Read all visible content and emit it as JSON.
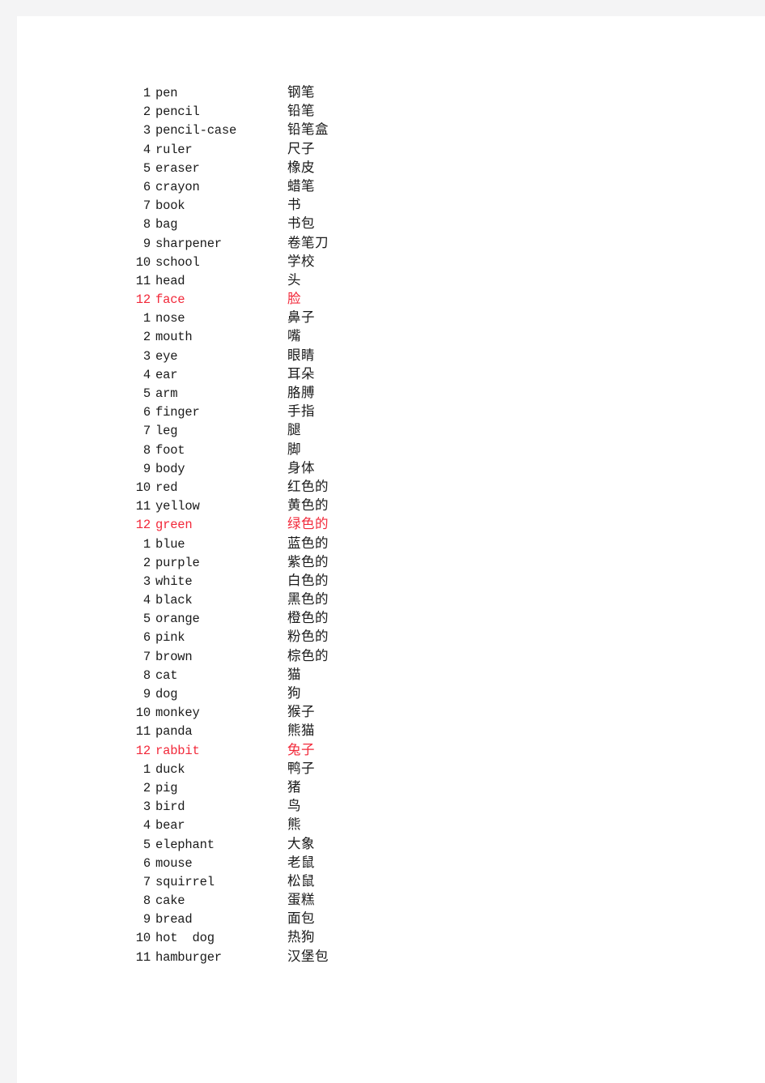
{
  "document": {
    "kind": "vocabulary-word-list",
    "accent_color": "#f2293a",
    "text_color": "#1a1a1a",
    "frame_color": "#f4f4f5",
    "page_color": "#ffffff"
  },
  "columns": {
    "index_header": "",
    "term_header": "",
    "gloss_header": ""
  },
  "rows": [
    {
      "index": "1",
      "term": "pen",
      "gloss": "钢笔",
      "highlight": false
    },
    {
      "index": "2",
      "term": "pencil",
      "gloss": "铅笔",
      "highlight": false
    },
    {
      "index": "3",
      "term": "pencil-case",
      "gloss": "铅笔盒",
      "highlight": false
    },
    {
      "index": "4",
      "term": "ruler",
      "gloss": "尺子",
      "highlight": false
    },
    {
      "index": "5",
      "term": "eraser",
      "gloss": "橡皮",
      "highlight": false
    },
    {
      "index": "6",
      "term": "crayon",
      "gloss": "蜡笔",
      "highlight": false
    },
    {
      "index": "7",
      "term": "book",
      "gloss": "书",
      "highlight": false
    },
    {
      "index": "8",
      "term": "bag",
      "gloss": "书包",
      "highlight": false
    },
    {
      "index": "9",
      "term": "sharpener",
      "gloss": "卷笔刀",
      "highlight": false
    },
    {
      "index": "10",
      "term": "school",
      "gloss": "学校",
      "highlight": false
    },
    {
      "index": "11",
      "term": "head",
      "gloss": "头",
      "highlight": false
    },
    {
      "index": "12",
      "term": "face",
      "gloss": "脸",
      "highlight": true
    },
    {
      "index": "1",
      "term": "nose",
      "gloss": "鼻子",
      "highlight": false
    },
    {
      "index": "2",
      "term": "mouth",
      "gloss": "嘴",
      "highlight": false
    },
    {
      "index": "3",
      "term": "eye",
      "gloss": "眼睛",
      "highlight": false
    },
    {
      "index": "4",
      "term": "ear",
      "gloss": "耳朵",
      "highlight": false
    },
    {
      "index": "5",
      "term": "arm",
      "gloss": "胳膊",
      "highlight": false
    },
    {
      "index": "6",
      "term": "finger",
      "gloss": "手指",
      "highlight": false
    },
    {
      "index": "7",
      "term": "leg",
      "gloss": "腿",
      "highlight": false
    },
    {
      "index": "8",
      "term": "foot",
      "gloss": "脚",
      "highlight": false
    },
    {
      "index": "9",
      "term": "body",
      "gloss": "身体",
      "highlight": false
    },
    {
      "index": "10",
      "term": "red",
      "gloss": "红色的",
      "highlight": false
    },
    {
      "index": "11",
      "term": "yellow",
      "gloss": "黄色的",
      "highlight": false
    },
    {
      "index": "12",
      "term": "green",
      "gloss": "绿色的",
      "highlight": true
    },
    {
      "index": "1",
      "term": "blue",
      "gloss": "蓝色的",
      "highlight": false
    },
    {
      "index": "2",
      "term": "purple",
      "gloss": "紫色的",
      "highlight": false
    },
    {
      "index": "3",
      "term": "white",
      "gloss": "白色的",
      "highlight": false
    },
    {
      "index": "4",
      "term": "black",
      "gloss": "黑色的",
      "highlight": false
    },
    {
      "index": "5",
      "term": "orange",
      "gloss": "橙色的",
      "highlight": false
    },
    {
      "index": "6",
      "term": "pink",
      "gloss": "粉色的",
      "highlight": false
    },
    {
      "index": "7",
      "term": "brown",
      "gloss": "棕色的",
      "highlight": false
    },
    {
      "index": "8",
      "term": "cat",
      "gloss": "猫",
      "highlight": false
    },
    {
      "index": "9",
      "term": "dog",
      "gloss": "狗",
      "highlight": false
    },
    {
      "index": "10",
      "term": "monkey",
      "gloss": "猴子",
      "highlight": false
    },
    {
      "index": "11",
      "term": "panda",
      "gloss": "熊猫",
      "highlight": false
    },
    {
      "index": "12",
      "term": "rabbit",
      "gloss": "兔子",
      "highlight": true
    },
    {
      "index": "1",
      "term": "duck",
      "gloss": "鸭子",
      "highlight": false
    },
    {
      "index": "2",
      "term": "pig",
      "gloss": "猪",
      "highlight": false
    },
    {
      "index": "3",
      "term": "bird",
      "gloss": "鸟",
      "highlight": false
    },
    {
      "index": "4",
      "term": "bear",
      "gloss": "熊",
      "highlight": false
    },
    {
      "index": "5",
      "term": "elephant",
      "gloss": "大象",
      "highlight": false
    },
    {
      "index": "6",
      "term": "mouse",
      "gloss": "老鼠",
      "highlight": false
    },
    {
      "index": "7",
      "term": "squirrel",
      "gloss": "松鼠",
      "highlight": false
    },
    {
      "index": "8",
      "term": "cake",
      "gloss": "蛋糕",
      "highlight": false
    },
    {
      "index": "9",
      "term": "bread",
      "gloss": "面包",
      "highlight": false
    },
    {
      "index": "10",
      "term": "hot  dog",
      "gloss": "热狗",
      "highlight": false
    },
    {
      "index": "11",
      "term": "hamburger",
      "gloss": "汉堡包",
      "highlight": false
    }
  ]
}
